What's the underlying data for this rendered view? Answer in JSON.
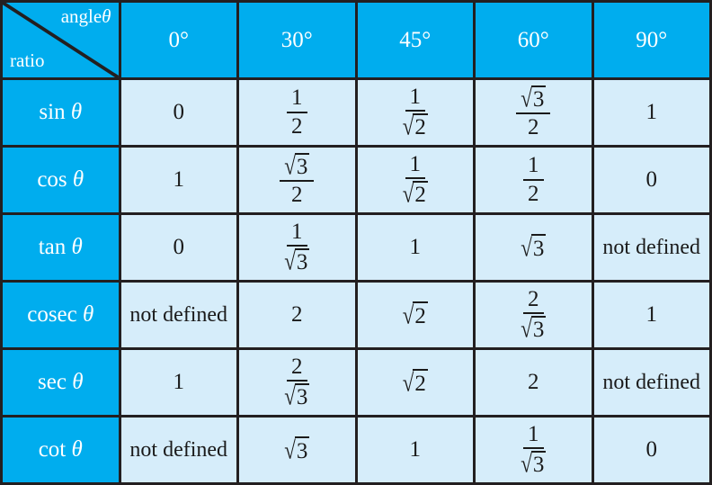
{
  "table": {
    "corner": {
      "angle_label": "angle",
      "angle_symbol": "θ",
      "ratio_label": "ratio"
    },
    "columns": [
      "0°",
      "30°",
      "45°",
      "60°",
      "90°"
    ],
    "rows": [
      {
        "name": "sin",
        "symbol": "θ",
        "values": [
          "0",
          "1/2",
          "1/√2",
          "√3/2",
          "1"
        ]
      },
      {
        "name": "cos",
        "symbol": "θ",
        "values": [
          "1",
          "√3/2",
          "1/√2",
          "1/2",
          "0"
        ]
      },
      {
        "name": "tan",
        "symbol": "θ",
        "values": [
          "0",
          "1/√3",
          "1",
          "√3",
          "not defined"
        ]
      },
      {
        "name": "cosec",
        "symbol": "θ",
        "values": [
          "not defined",
          "2",
          "√2",
          "2/√3",
          "1"
        ]
      },
      {
        "name": "sec",
        "symbol": "θ",
        "values": [
          "1",
          "2/√3",
          "√2",
          "2",
          "not defined"
        ]
      },
      {
        "name": "cot",
        "symbol": "θ",
        "values": [
          "not defined",
          "√3",
          "1",
          "1/√3",
          "0"
        ]
      }
    ],
    "cells": {
      "sin": {
        "0": {
          "kind": "plain",
          "text": "0"
        },
        "30": {
          "kind": "fraction",
          "num": "1",
          "den": "2"
        },
        "45": {
          "kind": "fraction",
          "num": "1",
          "den_sqrt": "2"
        },
        "60": {
          "kind": "fraction",
          "num_sqrt": "3",
          "den": "2"
        },
        "90": {
          "kind": "plain",
          "text": "1"
        }
      },
      "cos": {
        "0": {
          "kind": "plain",
          "text": "1"
        },
        "30": {
          "kind": "fraction",
          "num_sqrt": "3",
          "den": "2"
        },
        "45": {
          "kind": "fraction",
          "num": "1",
          "den_sqrt": "2"
        },
        "60": {
          "kind": "fraction",
          "num": "1",
          "den": "2"
        },
        "90": {
          "kind": "plain",
          "text": "0"
        }
      },
      "tan": {
        "0": {
          "kind": "plain",
          "text": "0"
        },
        "30": {
          "kind": "fraction",
          "num": "1",
          "den_sqrt": "3"
        },
        "45": {
          "kind": "plain",
          "text": "1"
        },
        "60": {
          "kind": "sqrt",
          "radicand": "3"
        },
        "90": {
          "kind": "text",
          "text": "not defined"
        }
      },
      "cosec": {
        "0": {
          "kind": "text",
          "text": "not defined"
        },
        "30": {
          "kind": "plain",
          "text": "2"
        },
        "45": {
          "kind": "sqrt",
          "radicand": "2"
        },
        "60": {
          "kind": "fraction",
          "num": "2",
          "den_sqrt": "3"
        },
        "90": {
          "kind": "plain",
          "text": "1"
        }
      },
      "sec": {
        "0": {
          "kind": "plain",
          "text": "1"
        },
        "30": {
          "kind": "fraction",
          "num": "2",
          "den_sqrt": "3"
        },
        "45": {
          "kind": "sqrt",
          "radicand": "2"
        },
        "60": {
          "kind": "plain",
          "text": "2"
        },
        "90": {
          "kind": "text",
          "text": "not defined"
        }
      },
      "cot": {
        "0": {
          "kind": "text",
          "text": "not defined"
        },
        "30": {
          "kind": "sqrt",
          "radicand": "3"
        },
        "45": {
          "kind": "plain",
          "text": "1"
        },
        "60": {
          "kind": "fraction",
          "num": "1",
          "den_sqrt": "3"
        },
        "90": {
          "kind": "plain",
          "text": "0"
        }
      }
    }
  },
  "colors": {
    "header_blue": "#00adee",
    "cell_blue": "#d6edfa",
    "border": "#231f20",
    "header_text": "#ffffff",
    "cell_text": "#1a1a1a"
  },
  "symbols": {
    "radical": "√"
  }
}
